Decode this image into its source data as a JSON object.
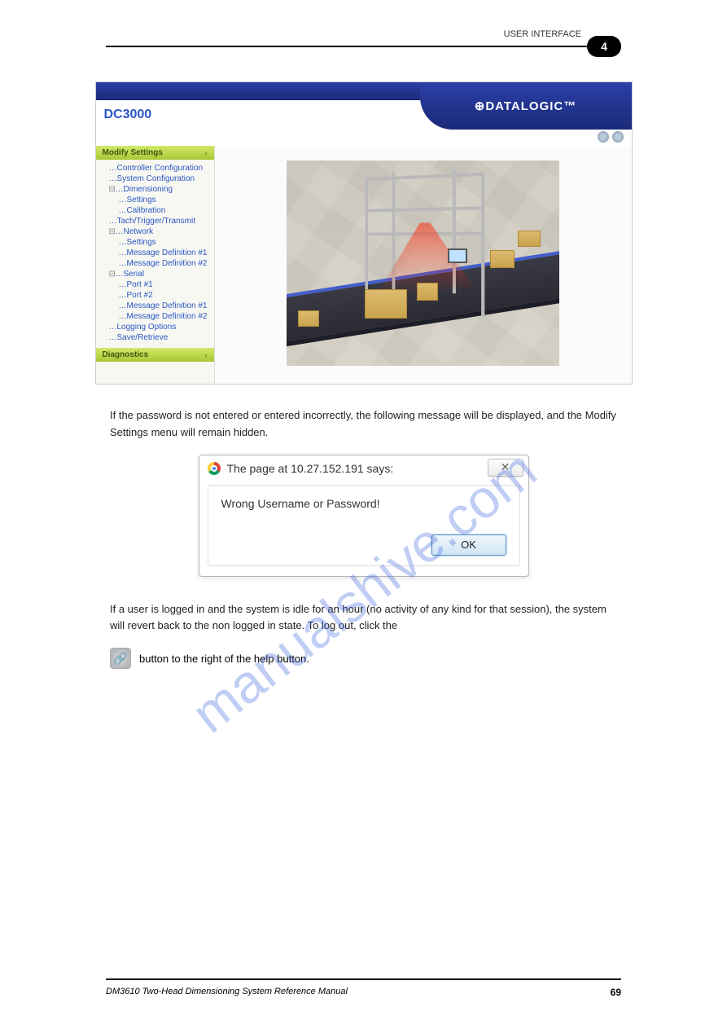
{
  "header": {
    "right_text": "USER INTERFACE",
    "chapter": "4"
  },
  "app": {
    "title": "DC3000",
    "brand": "⊕DATALOGIC™",
    "sections": {
      "modify": "Modify Settings",
      "diag": "Diagnostics"
    },
    "tree": [
      {
        "level": "l1",
        "label": "Controller Configuration"
      },
      {
        "level": "l1",
        "label": "System Configuration"
      },
      {
        "level": "l1",
        "label": "Dimensioning",
        "toggle": "⊟"
      },
      {
        "level": "l2",
        "label": "Settings"
      },
      {
        "level": "l2",
        "label": "Calibration"
      },
      {
        "level": "l1",
        "label": "Tach/Trigger/Transmit"
      },
      {
        "level": "l1",
        "label": "Network",
        "toggle": "⊟"
      },
      {
        "level": "l2",
        "label": "Settings"
      },
      {
        "level": "l2",
        "label": "Message Definition #1"
      },
      {
        "level": "l2",
        "label": "Message Definition #2"
      },
      {
        "level": "l1",
        "label": "Serial",
        "toggle": "⊟"
      },
      {
        "level": "l2",
        "label": "Port #1"
      },
      {
        "level": "l2",
        "label": "Port #2"
      },
      {
        "level": "l2",
        "label": "Message Definition #1"
      },
      {
        "level": "l2",
        "label": "Message Definition #2"
      },
      {
        "level": "l1",
        "label": "Logging Options"
      },
      {
        "level": "l1",
        "label": "Save/Retrieve"
      }
    ]
  },
  "paras": {
    "p1": "If the password is not entered or entered incorrectly, the following message will be displayed, and the Modify Settings menu will remain hidden.",
    "p2": "If a user is logged in and the system is idle for an hour (no activity of any kind for that session), the system will revert back to the non logged in state. To log out, click the",
    "p3": "button to the right of the help button."
  },
  "dialog": {
    "title": "The page at 10.27.152.191 says:",
    "message": "Wrong Username or Password!",
    "ok": "OK"
  },
  "lockicon": "🔗",
  "watermark": "manualshive.com",
  "footer": {
    "left": "DM3610 Two-Head Dimensioning System Reference Manual",
    "right": "69"
  }
}
